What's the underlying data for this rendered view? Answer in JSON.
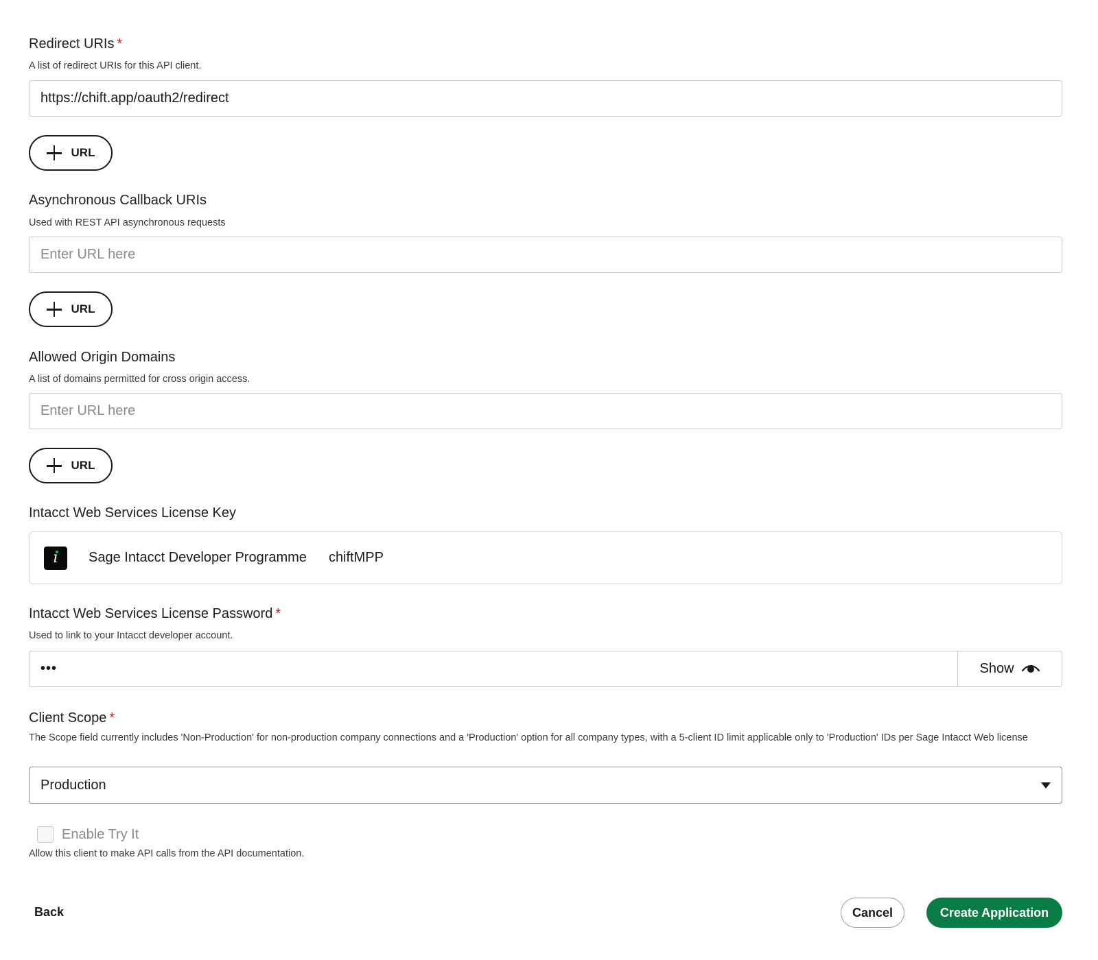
{
  "redirect": {
    "label": "Redirect URIs",
    "required_mark": "*",
    "helper": "A list of redirect URIs for this API client.",
    "value": "https://chift.app/oauth2/redirect",
    "add_label": "URL"
  },
  "callback": {
    "label": "Asynchronous Callback URIs",
    "helper": "Used with REST API asynchronous requests",
    "placeholder": "Enter URL here",
    "add_label": "URL"
  },
  "origins": {
    "label": "Allowed Origin Domains",
    "helper": "A list of domains permitted for cross origin access.",
    "placeholder": "Enter URL here",
    "add_label": "URL"
  },
  "license_key": {
    "label": "Intacct Web Services License Key",
    "name": "Sage Intacct Developer Programme",
    "id": "chiftMPP",
    "logo_icon": "sage-intacct-logo"
  },
  "license_password": {
    "label": "Intacct Web Services License Password",
    "required_mark": "*",
    "helper": "Used to link to your Intacct developer account.",
    "masked_value": "•••",
    "show_label": "Show"
  },
  "client_scope": {
    "label": "Client Scope",
    "required_mark": "*",
    "helper": "The Scope field currently includes 'Non-Production' for non-production company connections and a 'Production' option for all company types, with a 5-client ID limit applicable only to 'Production' IDs per Sage Intacct Web license",
    "selected": "Production"
  },
  "try_it": {
    "label": "Enable Try It",
    "helper": "Allow this client to make API calls from the API documentation.",
    "checked": false
  },
  "footer": {
    "back_label": "Back",
    "cancel_label": "Cancel",
    "create_label": "Create Application"
  },
  "colors": {
    "primary": "#0a7c45",
    "required": "#d0202a"
  }
}
